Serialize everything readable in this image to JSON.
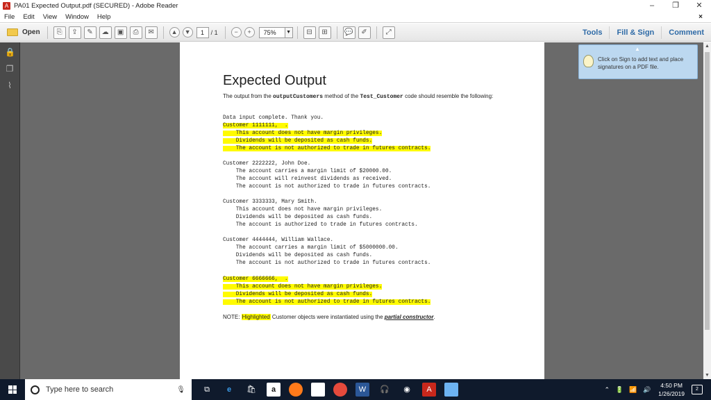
{
  "window": {
    "title": "PA01 Expected Output.pdf (SECURED) - Adobe Reader",
    "controls": [
      "–",
      "❐",
      "✕"
    ]
  },
  "menu": {
    "items": [
      "File",
      "Edit",
      "View",
      "Window",
      "Help"
    ],
    "close": "×"
  },
  "toolbar": {
    "open_label": "Open",
    "page_current": "1",
    "page_total": "/ 1",
    "zoom": "75%",
    "tools_label": "Tools",
    "fill_sign_label": "Fill & Sign",
    "comment_label": "Comment"
  },
  "tooltip": {
    "text": "Click on Sign to add text and place signatures on a PDF file."
  },
  "document": {
    "title": "Expected Output",
    "intro_prefix": "The output from the ",
    "intro_method": "outputCustomers",
    "intro_mid": " method of the ",
    "intro_class": "Test_Customer",
    "intro_suffix": " code should resemble the following:",
    "line_data_input": "Data input complete. Thank you.",
    "block1": {
      "header": "Customer 1111111,  .",
      "lines": [
        "    This account does not have margin privileges.",
        "    Dividends will be deposited as cash funds.",
        "    The account is not authorized to trade in futures contracts."
      ]
    },
    "block2": {
      "header": "Customer 2222222, John Doe.",
      "lines": [
        "    The account carries a margin limit of $20000.00.",
        "    The account will reinvest dividends as received.",
        "    The account is not authorized to trade in futures contracts."
      ]
    },
    "block3": {
      "header": "Customer 3333333, Mary Smith.",
      "lines": [
        "    This account does not have margin privileges.",
        "    Dividends will be deposited as cash funds.",
        "    The account is authorized to trade in futures contracts."
      ]
    },
    "block4": {
      "header": "Customer 4444444, William Wallace.",
      "lines": [
        "    The account carries a margin limit of $5000000.00.",
        "    Dividends will be deposited as cash funds.",
        "    The account is not authorized to trade in futures contracts."
      ]
    },
    "block5": {
      "header": "Customer 6666666,  .",
      "lines": [
        "    This account does not have margin privileges.",
        "    Dividends will be deposited as cash funds.",
        "    The account is not authorized to trade in futures contracts."
      ]
    },
    "note_prefix": "NOTE: ",
    "note_highlight": "Highlighted",
    "note_mid": " Customer objects were instantiated using the ",
    "note_link": "partial constructor",
    "note_suffix": "."
  },
  "taskbar": {
    "search_placeholder": "Type here to search",
    "clock_time": "4:50 PM",
    "clock_date": "1/26/2019",
    "notification_count": "2"
  }
}
